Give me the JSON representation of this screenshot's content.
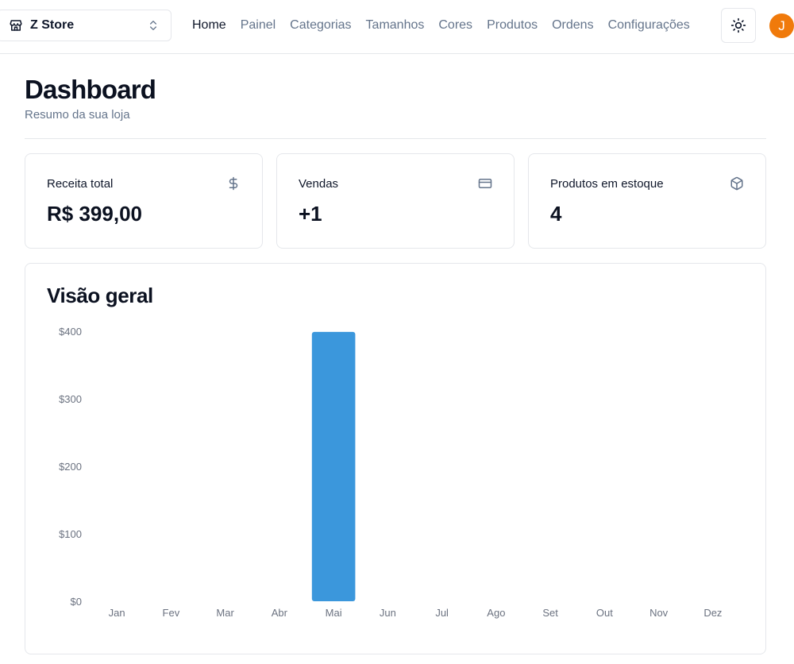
{
  "header": {
    "store_name": "Z Store",
    "nav": [
      {
        "label": "Home",
        "active": true
      },
      {
        "label": "Painel",
        "active": false
      },
      {
        "label": "Categorias",
        "active": false
      },
      {
        "label": "Tamanhos",
        "active": false
      },
      {
        "label": "Cores",
        "active": false
      },
      {
        "label": "Produtos",
        "active": false
      },
      {
        "label": "Ordens",
        "active": false
      },
      {
        "label": "Configurações",
        "active": false
      }
    ],
    "user_initial": "J",
    "avatar_color": "#f07a0b"
  },
  "page": {
    "title": "Dashboard",
    "subtitle": "Resumo da sua loja"
  },
  "stats": [
    {
      "label": "Receita total",
      "value": "R$ 399,00",
      "icon": "dollar-icon"
    },
    {
      "label": "Vendas",
      "value": "+1",
      "icon": "credit-card-icon"
    },
    {
      "label": "Produtos em estoque",
      "value": "4",
      "icon": "package-icon"
    }
  ],
  "overview": {
    "title": "Visão geral"
  },
  "chart_data": {
    "type": "bar",
    "categories": [
      "Jan",
      "Fev",
      "Mar",
      "Abr",
      "Mai",
      "Jun",
      "Jul",
      "Ago",
      "Set",
      "Out",
      "Nov",
      "Dez"
    ],
    "values": [
      0,
      0,
      0,
      0,
      399,
      0,
      0,
      0,
      0,
      0,
      0,
      0
    ],
    "ylim": [
      0,
      400
    ],
    "yticks": [
      0,
      100,
      200,
      300,
      400
    ],
    "ytick_labels": [
      "$0",
      "$100",
      "$200",
      "$300",
      "$400"
    ],
    "bar_color": "#3b97dc",
    "grid": false,
    "title": "",
    "xlabel": "",
    "ylabel": ""
  }
}
